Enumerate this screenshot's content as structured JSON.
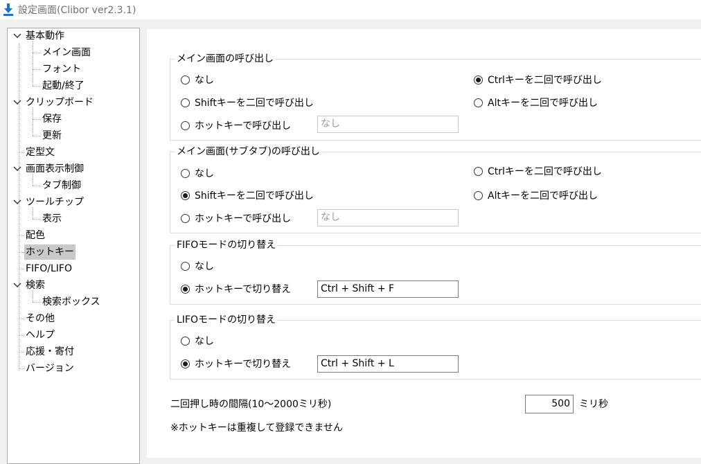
{
  "window": {
    "title": "設定画面(Clibor ver2.3.1)"
  },
  "tree": [
    {
      "label": "基本動作",
      "expanded": true
    },
    {
      "label": "メイン画面"
    },
    {
      "label": "フォント"
    },
    {
      "label": "起動/終了"
    },
    {
      "label": "クリップボード",
      "expanded": true
    },
    {
      "label": "保存"
    },
    {
      "label": "更新"
    },
    {
      "label": "定型文"
    },
    {
      "label": "画面表示制御",
      "expanded": true
    },
    {
      "label": "タブ制御"
    },
    {
      "label": "ツールチップ",
      "expanded": true
    },
    {
      "label": "表示"
    },
    {
      "label": "配色"
    },
    {
      "label": "ホットキー",
      "selected": true
    },
    {
      "label": "FIFO/LIFO"
    },
    {
      "label": "検索",
      "expanded": true
    },
    {
      "label": "検索ボックス"
    },
    {
      "label": "その他"
    },
    {
      "label": "ヘルプ"
    },
    {
      "label": "応援・寄付"
    },
    {
      "label": "バージョン"
    }
  ],
  "groups": {
    "main": {
      "title": "メイン画面の呼び出し",
      "opt_none": "なし",
      "opt_ctrl": "Ctrlキーを二回で呼び出し",
      "opt_shift": "Shiftキーを二回で呼び出し",
      "opt_alt": "Altキーを二回で呼び出し",
      "opt_hotkey": "ホットキーで呼び出し",
      "hotkey_value": "なし",
      "selected": "ctrl"
    },
    "sub": {
      "title": "メイン画面(サブタブ)の呼び出し",
      "opt_none": "なし",
      "opt_ctrl": "Ctrlキーを二回で呼び出し",
      "opt_shift": "Shiftキーを二回で呼び出し",
      "opt_alt": "Altキーを二回で呼び出し",
      "opt_hotkey": "ホットキーで呼び出し",
      "hotkey_value": "なし",
      "selected": "shift"
    },
    "fifo": {
      "title": "FIFOモードの切り替え",
      "opt_none": "なし",
      "opt_hotkey": "ホットキーで切り替え",
      "hotkey_value": "Ctrl + Shift + F",
      "selected": "hotkey"
    },
    "lifo": {
      "title": "LIFOモードの切り替え",
      "opt_none": "なし",
      "opt_hotkey": "ホットキーで切り替え",
      "hotkey_value": "Ctrl + Shift + L",
      "selected": "hotkey"
    }
  },
  "interval": {
    "label": "二回押し時の間隔(10～2000ミリ秒)",
    "value": "500",
    "unit": "ミリ秒"
  },
  "note": "※ホットキーは重複して登録できません",
  "colors": {
    "selection": "#c9c9c9",
    "icon_blue": "#1a73c8"
  }
}
